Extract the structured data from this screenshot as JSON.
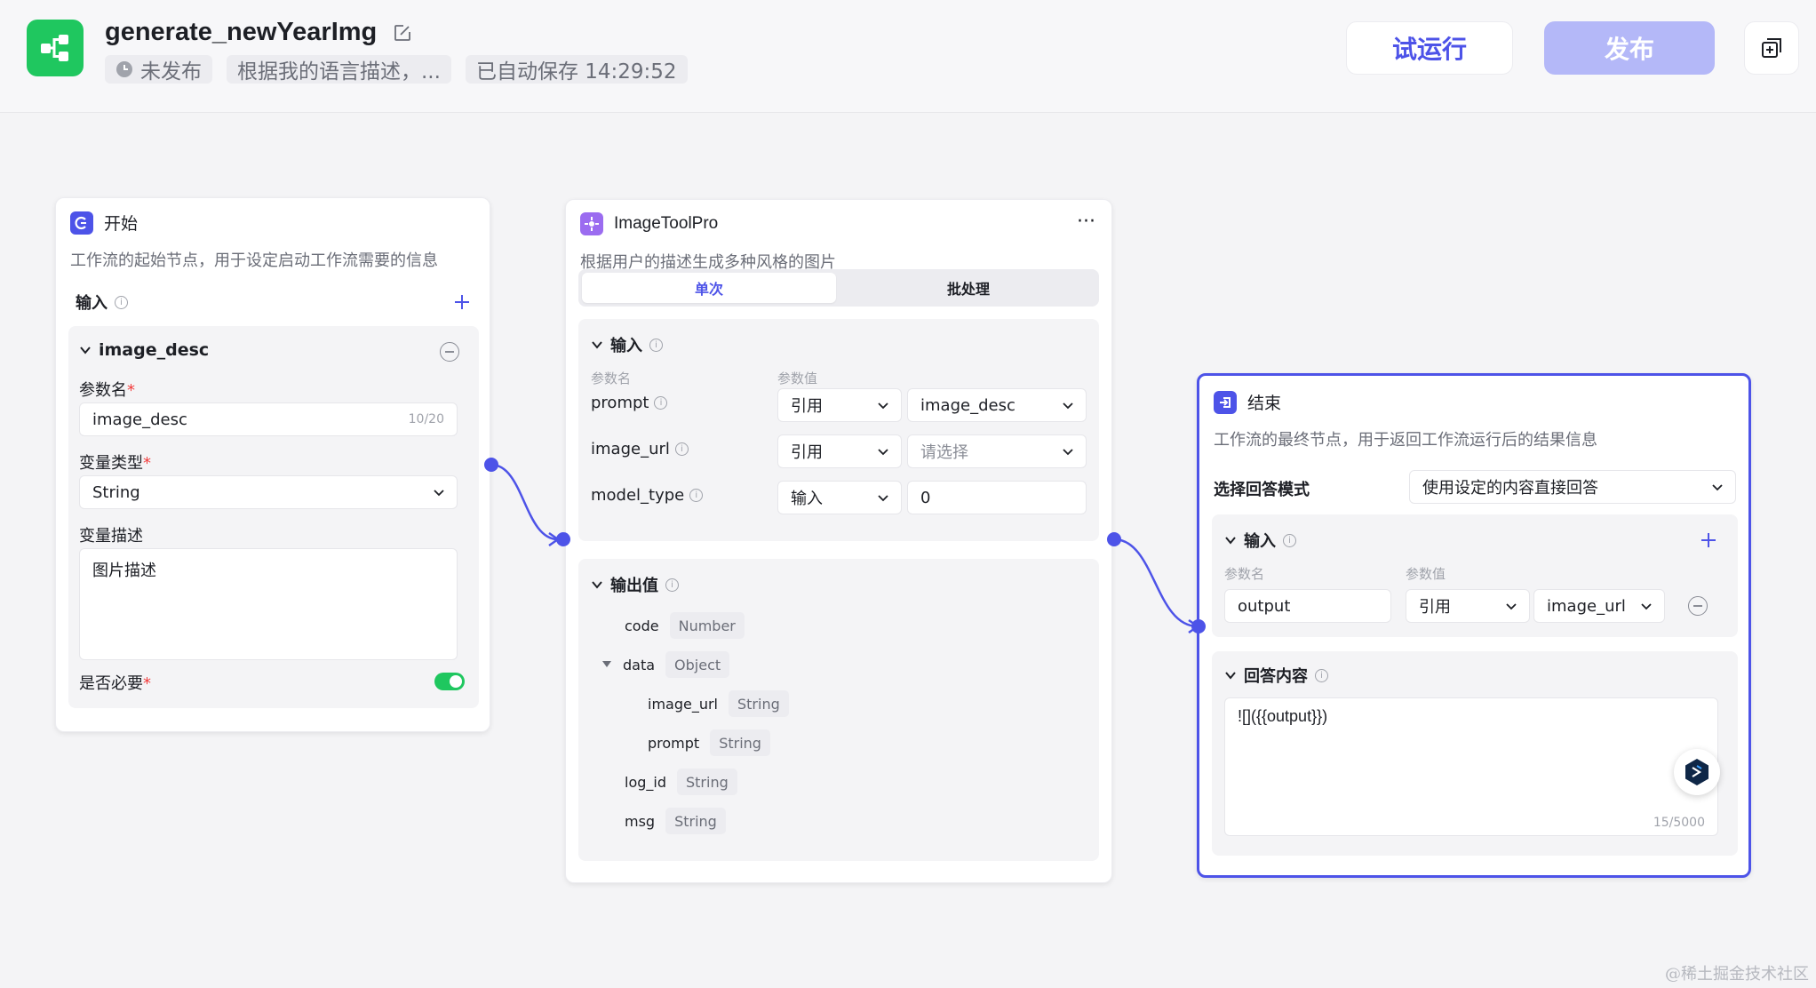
{
  "header": {
    "app_title": "generate_newYearImg",
    "status": "未发布",
    "description": "根据我的语言描述，...",
    "autosave": "已自动保存 14:29:52",
    "run_label": "试运行",
    "publish_label": "发布"
  },
  "start_node": {
    "title": "开始",
    "desc": "工作流的起始节点，用于设定启动工作流需要的信息",
    "input_label": "输入",
    "param_name": "image_desc",
    "param_name_label": "参数名",
    "param_name_value": "image_desc",
    "param_name_count": "10/20",
    "var_type_label": "变量类型",
    "var_type_value": "String",
    "var_desc_label": "变量描述",
    "var_desc_value": "图片描述",
    "required_label": "是否必要",
    "required_asterisk": "*",
    "required_on": true
  },
  "tool_node": {
    "title": "ImageToolPro",
    "desc": "根据用户的描述生成多种风格的图片",
    "more": "···",
    "tab_single": "单次",
    "tab_batch": "批处理",
    "input_label": "输入",
    "col_name": "参数名",
    "col_value": "参数值",
    "params": [
      {
        "name": "prompt",
        "mode": "引用",
        "value": "image_desc",
        "value_is_placeholder": false
      },
      {
        "name": "image_url",
        "mode": "引用",
        "value": "请选择",
        "value_is_placeholder": true
      },
      {
        "name": "model_type",
        "mode": "输入",
        "value": "0",
        "value_is_placeholder": false
      }
    ],
    "output_label": "输出值",
    "outputs": [
      {
        "name": "code",
        "type": "Number"
      },
      {
        "name": "data",
        "type": "Object"
      },
      {
        "name": "image_url",
        "type": "String"
      },
      {
        "name": "prompt",
        "type": "String"
      },
      {
        "name": "log_id",
        "type": "String"
      },
      {
        "name": "msg",
        "type": "String"
      }
    ]
  },
  "end_node": {
    "title": "结束",
    "desc": "工作流的最终节点，用于返回工作流运行后的结果信息",
    "mode_label": "选择回答模式",
    "mode_value": "使用设定的内容直接回答",
    "input_label": "输入",
    "col_name": "参数名",
    "col_value": "参数值",
    "output_name": "output",
    "output_mode": "引用",
    "output_value": "image_url",
    "answer_label": "回答内容",
    "answer_text": "![]({{output}})",
    "answer_count": "15/5000"
  },
  "watermark": "@稀土掘金技术社区",
  "colors": {
    "accent": "#4d53e8",
    "brand_green": "#1fc75f",
    "publish_disabled": "#b4b8f8"
  }
}
